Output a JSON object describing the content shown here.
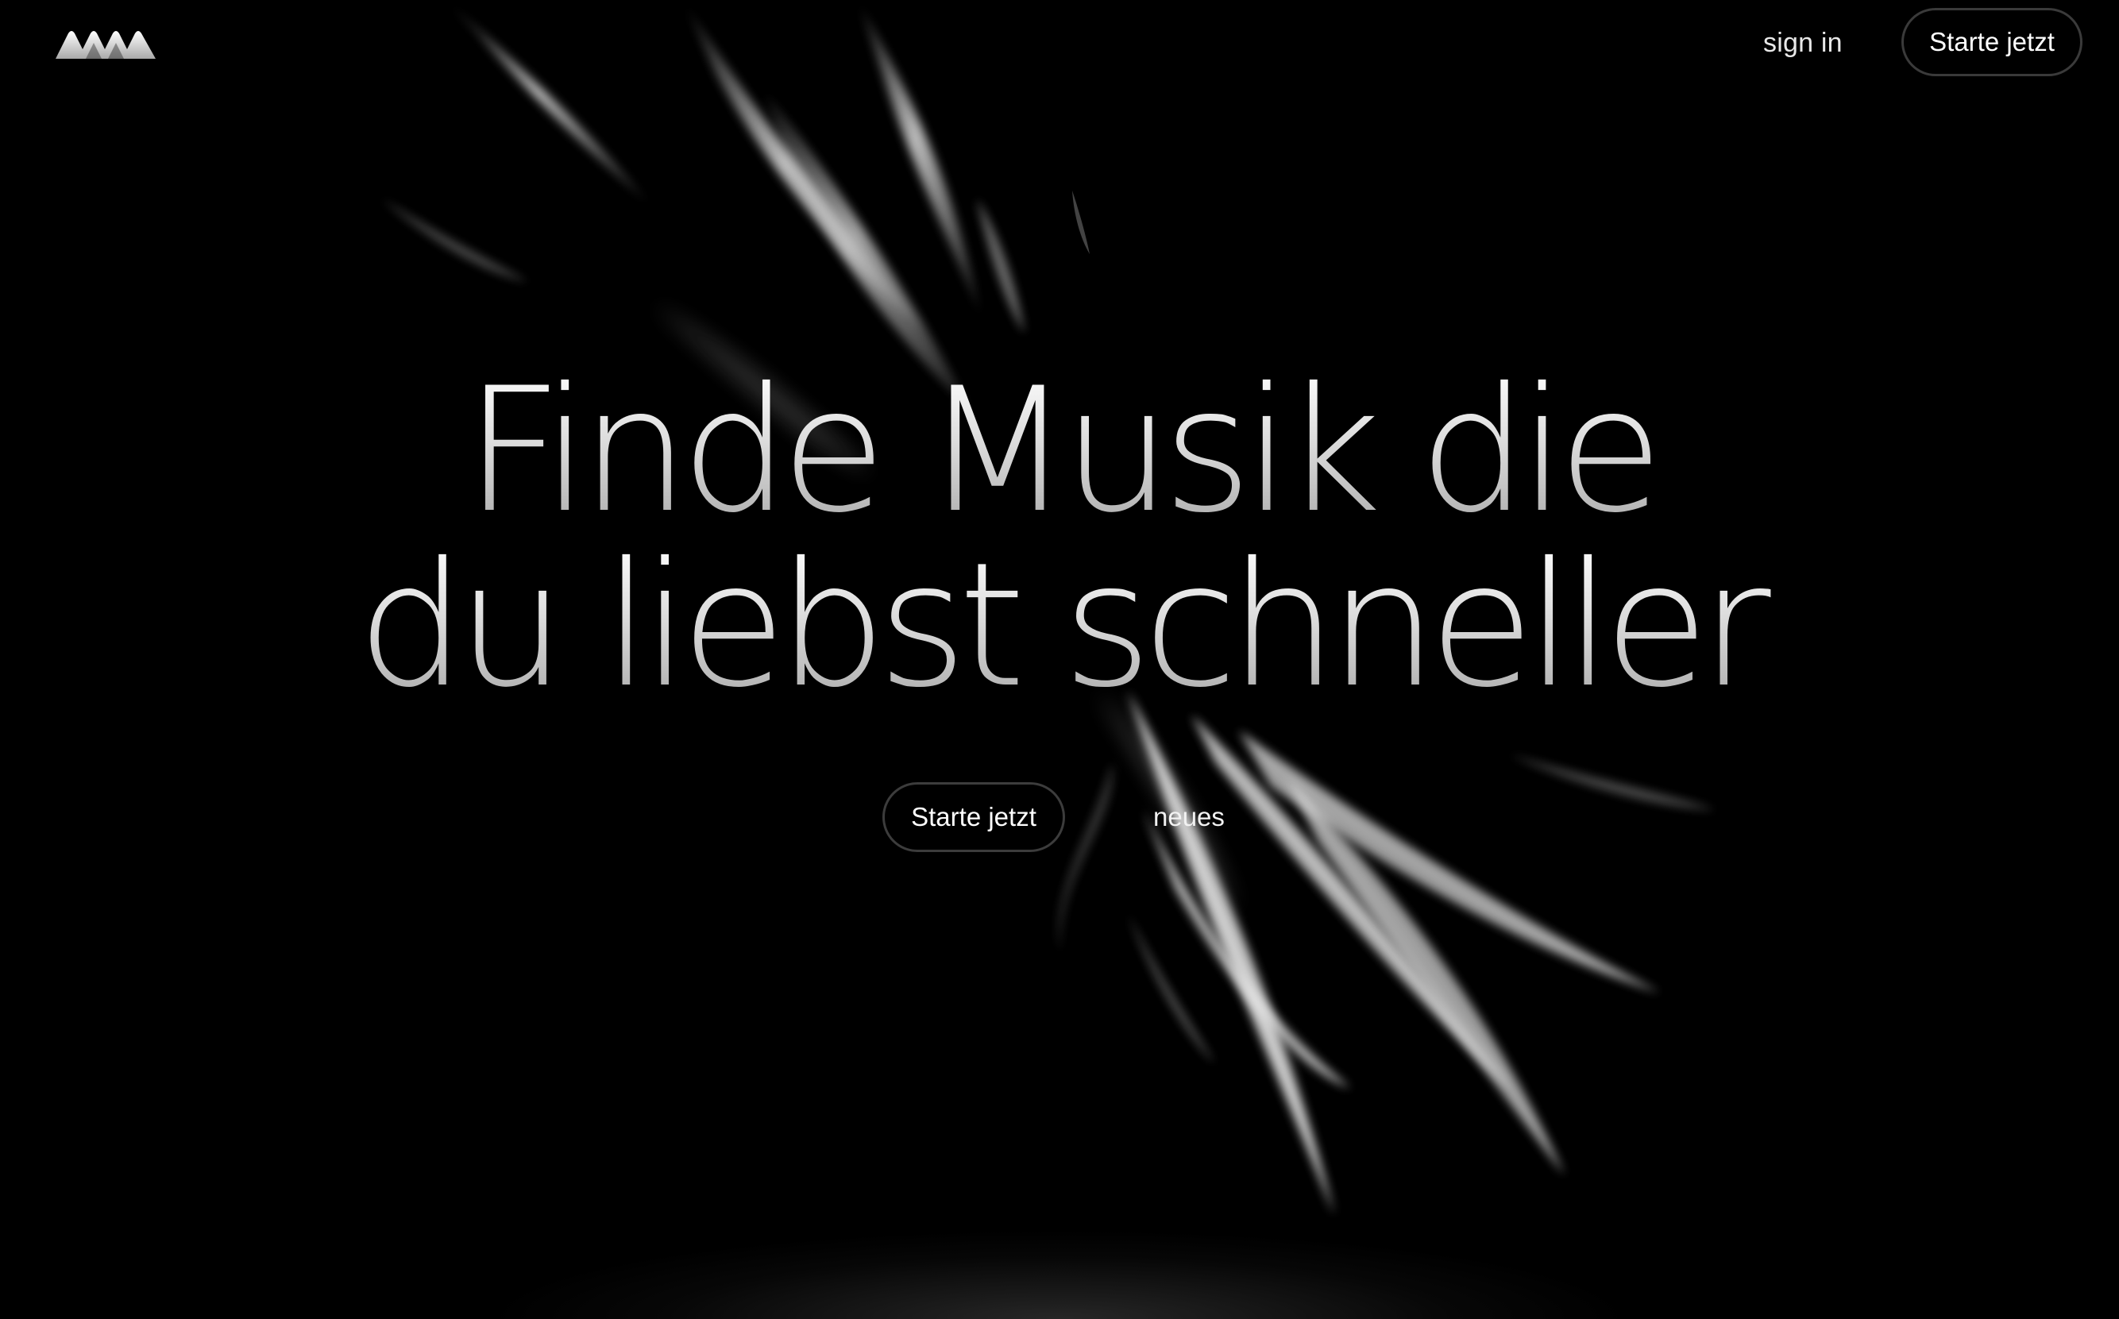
{
  "header": {
    "logo_icon": "triangle-wave-logo-icon",
    "signin_label": "sign in",
    "cta_label": "Starte jetzt"
  },
  "hero": {
    "title_line1": "Finde Musik die",
    "title_line2": "du liebst schneller",
    "primary_cta_label": "Starte jetzt",
    "secondary_link_label": "neues"
  },
  "theme": {
    "background": "#000000",
    "text": "#ffffff",
    "button_border": "#3a3a3a"
  }
}
